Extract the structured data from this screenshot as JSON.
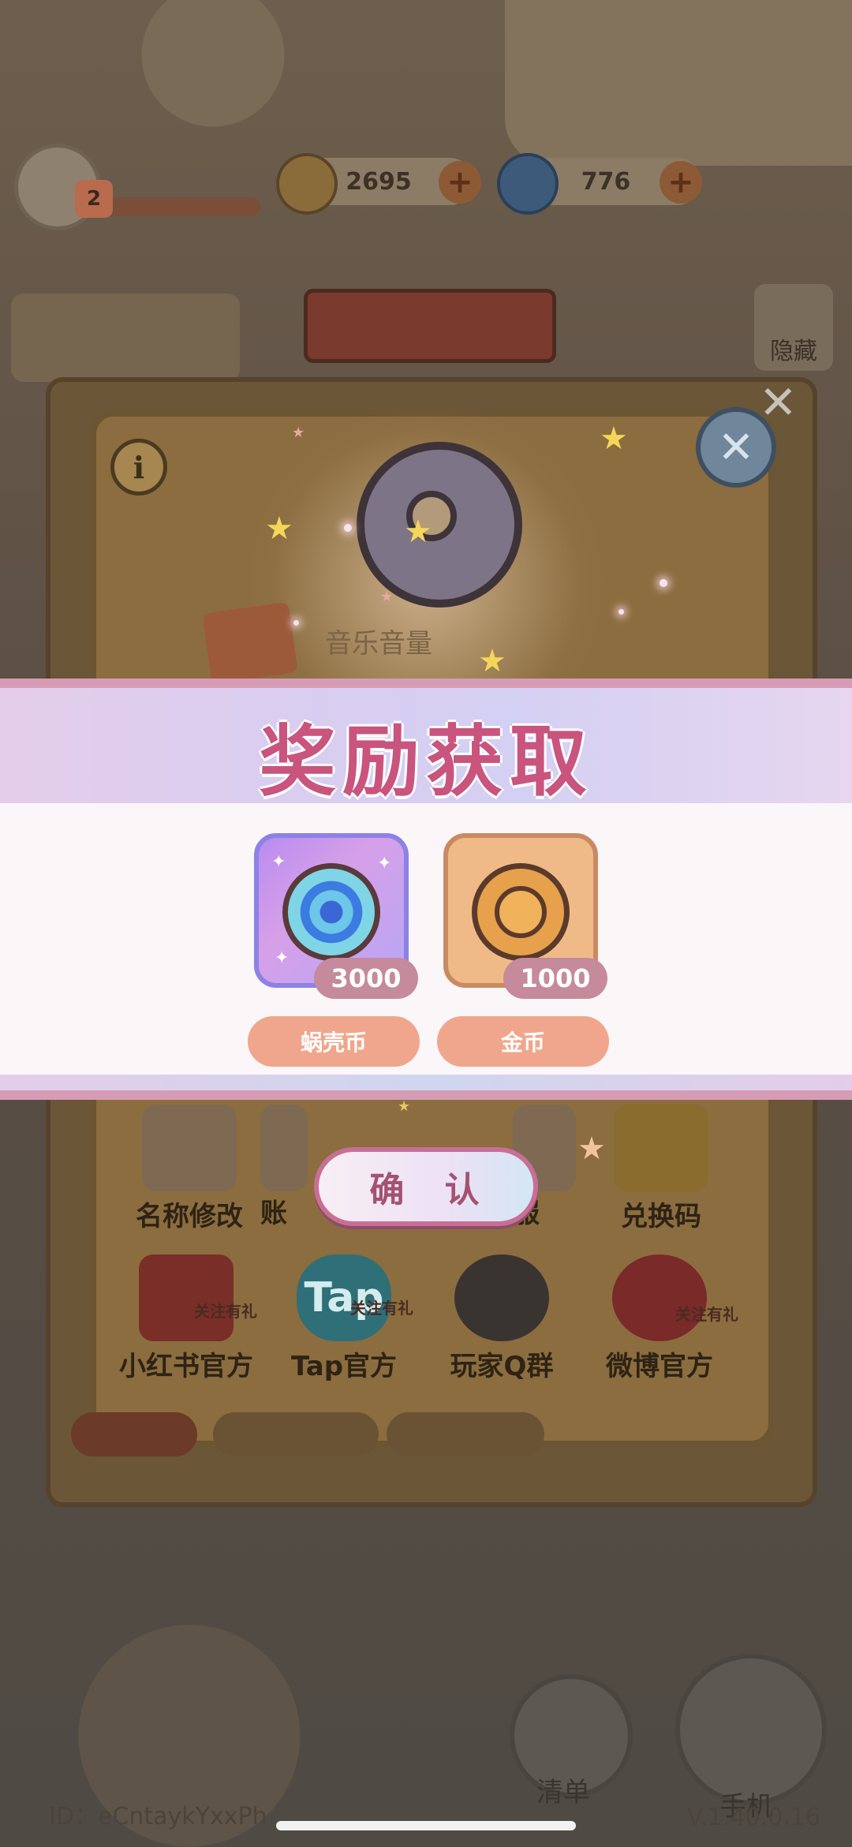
{
  "hud": {
    "level": "2",
    "gold_amount": "2695",
    "shell_amount": "776",
    "hide_label": "隐藏"
  },
  "settings": {
    "music_volume_label": "音乐音量",
    "info_label": "i",
    "grid_row1": [
      "名称修改",
      "账",
      "服",
      "兑换码"
    ],
    "grid_row2": [
      "小红书官方",
      "Tap官方",
      "玩家Q群",
      "微博官方"
    ],
    "follow_gift_tag": "关注有礼",
    "tap_icon_text": "Tap"
  },
  "reward": {
    "title": "奖励获取",
    "items": [
      {
        "name": "蜗壳币",
        "count": "3000"
      },
      {
        "name": "金币",
        "count": "1000"
      }
    ],
    "confirm_label": "确 认"
  },
  "bottom": {
    "list_label": "清单",
    "phone_label": "手机",
    "id_text": "ID：eCntaykYxxPh",
    "version_text": "V.1.40.0.16"
  },
  "colors": {
    "title_pink": "#c9547e",
    "confirm_border": "#c86f96",
    "name_pill": "#f0a68c",
    "count_pill": "#c58a9c"
  }
}
